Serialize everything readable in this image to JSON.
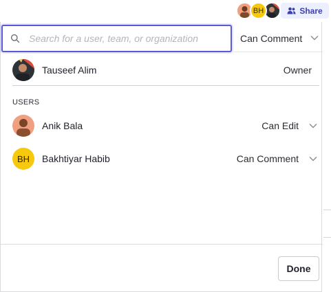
{
  "topbar": {
    "avatars": [
      {
        "name": "avatar-anik",
        "initials": ""
      },
      {
        "name": "avatar-bakhtiyar",
        "initials": "BH"
      },
      {
        "name": "avatar-tauseef",
        "initials": ""
      }
    ],
    "share_label": "Share",
    "share_icon": "users-icon"
  },
  "dialog": {
    "search": {
      "placeholder": "Search for a user, team, or organization",
      "value": "",
      "icon": "search-icon"
    },
    "permission_select": {
      "value": "Can Comment"
    },
    "owner": {
      "name": "Tauseef Alim",
      "role": "Owner"
    },
    "users_heading": "USERS",
    "users": [
      {
        "name": "Anik Bala",
        "role": "Can Edit",
        "initials": ""
      },
      {
        "name": "Bakhtiyar Habib",
        "role": "Can Comment",
        "initials": "BH"
      }
    ],
    "done_label": "Done"
  },
  "colors": {
    "accent": "#5b5ad6",
    "share_bg": "#eceffd",
    "share_text": "#3b3fb0",
    "initials_avatar": "#f6c90e"
  }
}
